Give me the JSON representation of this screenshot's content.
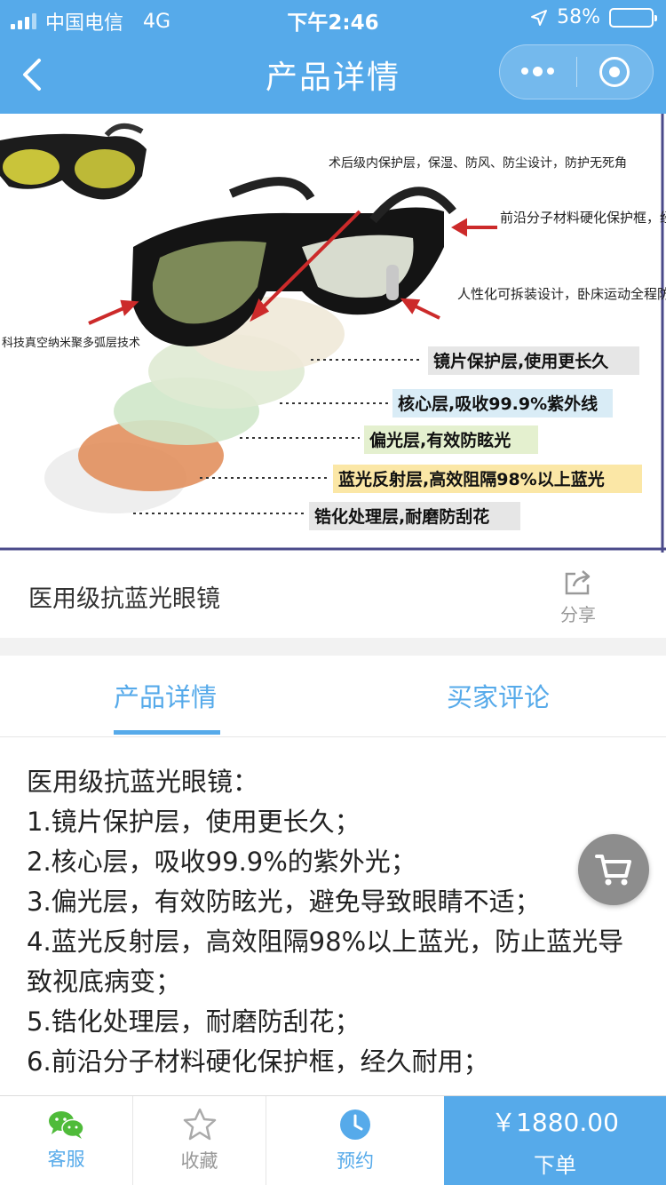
{
  "status_bar": {
    "carrier": "中国电信",
    "network": "4G",
    "time": "下午2:46",
    "battery_percent": "58%",
    "battery_level": 0.58
  },
  "nav": {
    "title": "产品详情",
    "icons": [
      "back-arrow",
      "more-dots",
      "close-target"
    ]
  },
  "product_image": {
    "callouts": [
      "术后级内保护层，保湿、防风、防尘设计，防护无死角",
      "前沿分子材料硬化保护框，经久耐用",
      "人性化可拆装设计，卧床运动全程防护",
      "科技真空纳米聚多弧层技术",
      "镜片保护层,使用更长久",
      "核心层,吸收99.9%紫外线",
      "偏光层,有效防眩光",
      "蓝光反射层,高效阻隔98%以上蓝光",
      "锆化处理层,耐磨防刮花"
    ]
  },
  "product": {
    "name": "医用级抗蓝光眼镜",
    "share_label": "分享"
  },
  "tabs": [
    {
      "label": "产品详情",
      "active": true
    },
    {
      "label": "买家评论",
      "active": false
    }
  ],
  "description": [
    "医用级抗蓝光眼镜：",
    "1.镜片保护层，使用更长久；",
    "2.核心层，吸收99.9%的紫外光；",
    "3.偏光层，有效防眩光，避免导致眼睛不适；",
    "4.蓝光反射层，高效阻隔98%以上蓝光，防止蓝光导致视底病变；",
    "5.锆化处理层，耐磨防刮花；",
    "6.前沿分子材料硬化保护框，经久耐用；"
  ],
  "bottom_bar": {
    "customer_service": "客服",
    "favorite": "收藏",
    "reserve": "预约",
    "price": "￥1880.00",
    "order": "下单"
  },
  "colors": {
    "accent": "#56aaea",
    "fab": "#8d8d8d"
  }
}
